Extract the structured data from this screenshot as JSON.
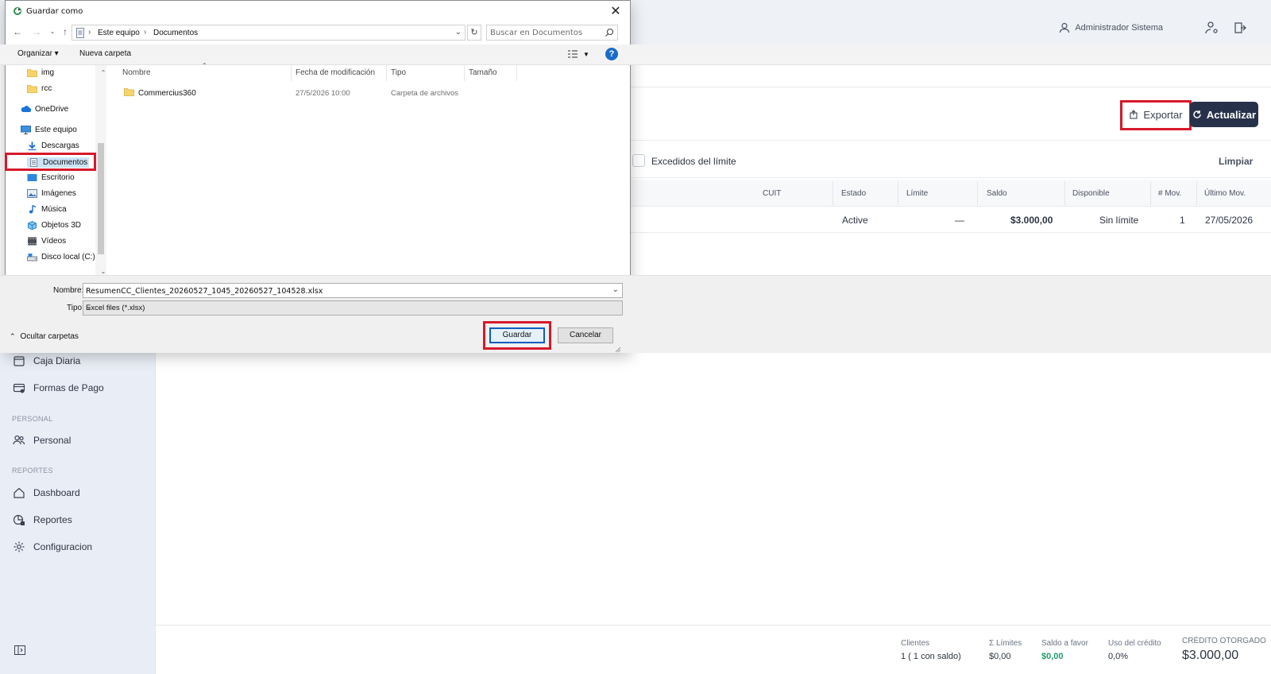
{
  "app": {
    "user_name": "Administrador Sistema",
    "export_label": "Exportar",
    "refresh_label": "Actualizar",
    "filter_label": "Excedidos del límite",
    "clear_label": "Limpiar",
    "sidebar": {
      "items_top": [
        {
          "label": "Caja Diaria",
          "icon": "calendar-icon"
        },
        {
          "label": "Formas de Pago",
          "icon": "card-icon"
        }
      ],
      "section_personal": "PERSONAL",
      "items_personal": [
        {
          "label": "Personal",
          "icon": "people-icon"
        }
      ],
      "section_reportes": "REPORTES",
      "items_reportes": [
        {
          "label": "Dashboard",
          "icon": "home-icon"
        },
        {
          "label": "Reportes",
          "icon": "report-icon"
        },
        {
          "label": "Configuracion",
          "icon": "gear-icon"
        }
      ]
    },
    "table": {
      "headers": [
        "CUIT",
        "Estado",
        "Límite",
        "Saldo",
        "Disponible",
        "# Mov.",
        "Último Mov."
      ],
      "rows": [
        {
          "cuit": "",
          "estado": "Active",
          "limite": "—",
          "saldo": "$3.000,00",
          "disponible": "Sin límite",
          "mov": "1",
          "ultimo": "27/05/2026"
        }
      ]
    },
    "footer": {
      "clientes_label": "Clientes",
      "clientes_value": "1 ( 1  con saldo)",
      "limites_label": "Σ Límites",
      "limites_value": "$0,00",
      "favor_label": "Saldo a favor",
      "favor_value": "$0,00",
      "uso_label": "Uso del crédito",
      "uso_value": "0,0%",
      "credito_label": "CRÉDITO OTORGADO",
      "credito_value": "$3.000,00"
    },
    "colors": {
      "accent_dark": "#27324a",
      "highlight_red": "#d6192a",
      "positive_green": "#1f9d6a"
    }
  },
  "dialog": {
    "title": "Guardar como",
    "close_glyph": "✕",
    "breadcrumb": [
      "Este equipo",
      "Documentos"
    ],
    "search_placeholder": "Buscar en Documentos",
    "organize_label": "Organizar ▾",
    "new_folder_label": "Nueva carpeta",
    "help_glyph": "?",
    "nav_items": [
      {
        "label": "img",
        "icon": "folder-icon"
      },
      {
        "label": "rcc",
        "icon": "folder-icon"
      },
      {
        "label": "OneDrive",
        "icon": "cloud-icon"
      },
      {
        "label": "Este equipo",
        "icon": "computer-icon"
      },
      {
        "label": "Descargas",
        "icon": "download-icon"
      },
      {
        "label": "Documentos",
        "icon": "document-icon"
      },
      {
        "label": "Escritorio",
        "icon": "desktop-icon"
      },
      {
        "label": "Imágenes",
        "icon": "image-icon"
      },
      {
        "label": "Música",
        "icon": "music-icon"
      },
      {
        "label": "Objetos 3D",
        "icon": "cube-icon"
      },
      {
        "label": "Vídeos",
        "icon": "video-icon"
      },
      {
        "label": "Disco local (C:)",
        "icon": "drive-icon"
      }
    ],
    "columns": [
      "Nombre",
      "Fecha de modificación",
      "Tipo",
      "Tamaño"
    ],
    "files": [
      {
        "name": "Commercius360",
        "date": "27/5/2026 10:00",
        "type": "Carpeta de archivos",
        "size": ""
      }
    ],
    "name_label": "Nombre:",
    "name_value": "ResumenCC_Clientes_20260527_1045_20260527_104528.xlsx",
    "type_label": "Tipo:",
    "type_value": "Excel files (*.xlsx)",
    "hide_folders_label": "Ocultar carpetas",
    "save_label": "Guardar",
    "cancel_label": "Cancelar"
  }
}
